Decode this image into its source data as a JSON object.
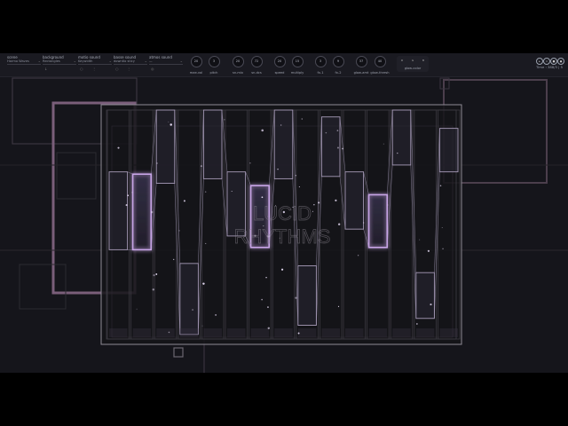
{
  "toolbar": {
    "dropdowns": [
      {
        "label": "scene",
        "value": "Harmo Waves"
      },
      {
        "label": "background",
        "value": "Rectangles"
      },
      {
        "label": "motio sound",
        "value": "Keywidth"
      },
      {
        "label": "basse sound",
        "value": "downtio sticy"
      },
      {
        "label": "atmos sound",
        "value": "—"
      }
    ],
    "knobs": [
      {
        "label": "mae-vol",
        "value": "20"
      },
      {
        "label": "pitch",
        "value": "3"
      },
      {
        "label": "sn-mix",
        "value": "20"
      },
      {
        "label": "sn-dcs",
        "value": "72"
      },
      {
        "label": "speed",
        "value": "20"
      },
      {
        "label": "multiply",
        "value": "15"
      },
      {
        "label": "fx-1",
        "value": "3"
      },
      {
        "label": "fx-2",
        "value": "9"
      },
      {
        "label": "glow-amt",
        "value": "37"
      },
      {
        "label": "glow-thresh",
        "value": "40"
      }
    ],
    "glow_color": {
      "label": "glow-color",
      "pills": [
        "R",
        "G",
        "B"
      ]
    },
    "transport": {
      "buttons": [
        "play-icon",
        "pause-icon",
        "stop-icon",
        "record-icon"
      ],
      "time": "Time : 388/3 | 5"
    }
  },
  "overlay": {
    "title_line1": "LUCID",
    "title_line2": "RHYTHMS"
  },
  "colors": {
    "accent": "#c9a6e8",
    "bg": "#15151b",
    "frame": "#9a8aa0"
  },
  "bars": [
    {
      "lo": 0.39,
      "hi": 0.73
    },
    {
      "lo": 0.39,
      "hi": 0.72,
      "bright": true
    },
    {
      "lo": 0.68,
      "hi": 1.0
    },
    {
      "lo": 0.02,
      "hi": 0.33
    },
    {
      "lo": 0.7,
      "hi": 1.0
    },
    {
      "lo": 0.45,
      "hi": 0.73
    },
    {
      "lo": 0.4,
      "hi": 0.67,
      "bright": true
    },
    {
      "lo": 0.7,
      "hi": 1.0
    },
    {
      "lo": 0.06,
      "hi": 0.32
    },
    {
      "lo": 0.71,
      "hi": 0.97
    },
    {
      "lo": 0.48,
      "hi": 0.73
    },
    {
      "lo": 0.4,
      "hi": 0.63,
      "bright": true
    },
    {
      "lo": 0.76,
      "hi": 1.0
    },
    {
      "lo": 0.09,
      "hi": 0.29
    },
    {
      "lo": 0.73,
      "hi": 0.92
    }
  ]
}
